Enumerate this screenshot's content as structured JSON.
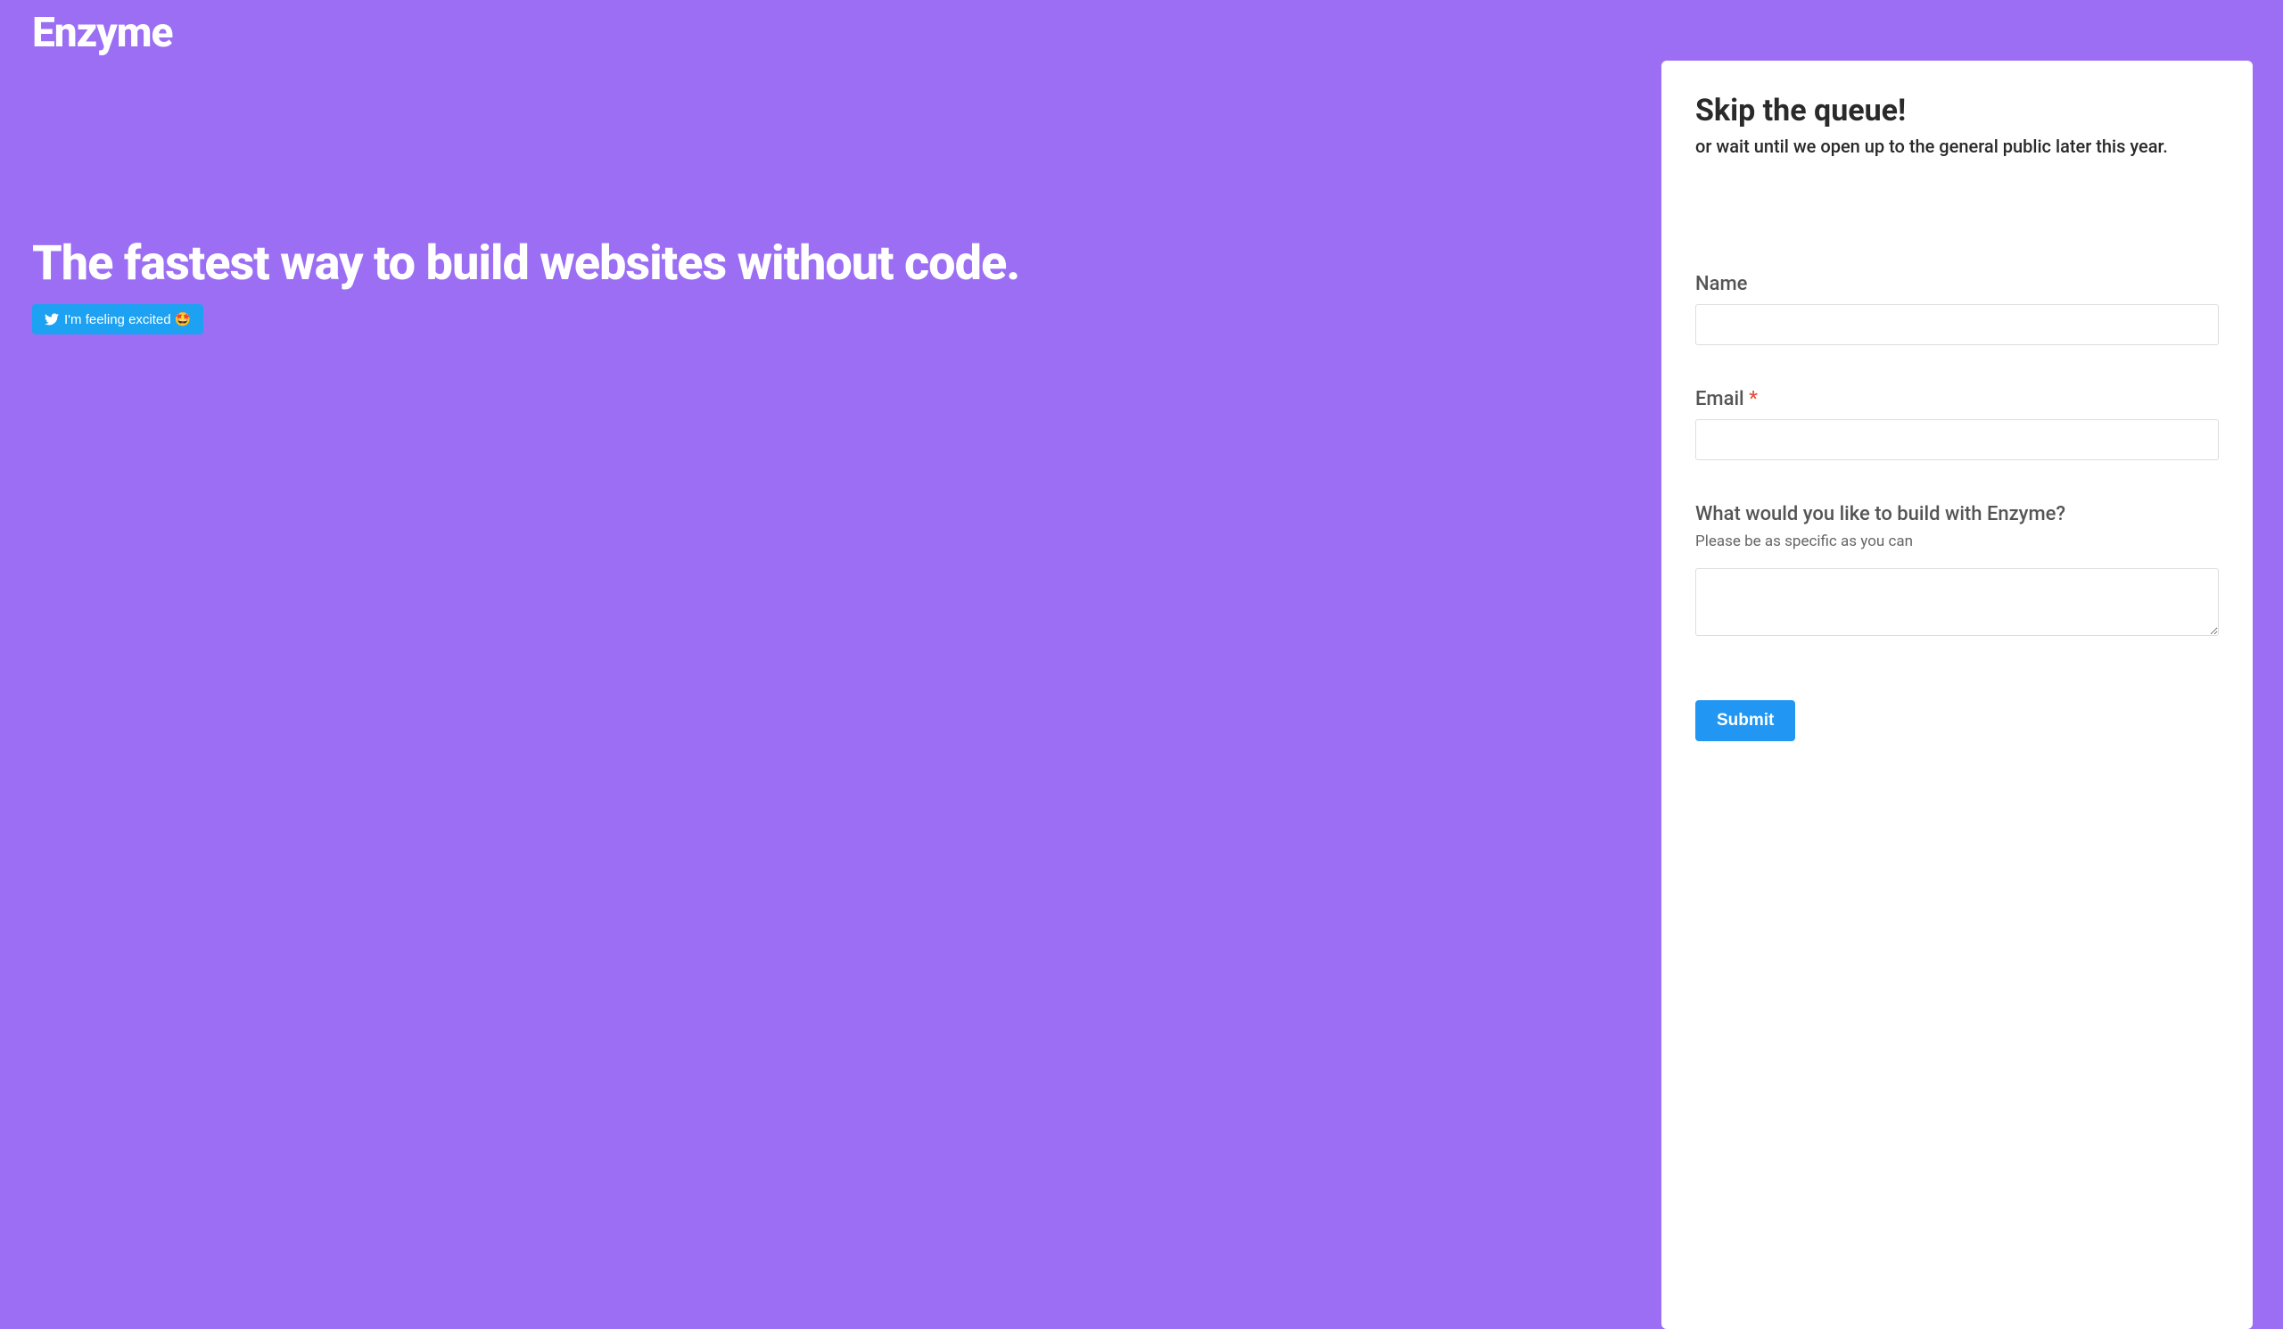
{
  "brand": {
    "name": "Enzyme"
  },
  "hero": {
    "title": "The fastest way to build websites without code.",
    "tweet_button_label": "I'm feeling excited 🤩"
  },
  "form": {
    "title": "Skip the queue!",
    "subtitle": "or wait until we open up to the general public later this year.",
    "fields": {
      "name": {
        "label": "Name",
        "value": ""
      },
      "email": {
        "label": "Email",
        "required_marker": "*",
        "value": ""
      },
      "build": {
        "label": "What would you like to build with Enzyme?",
        "hint": "Please be as specific as you can",
        "value": ""
      }
    },
    "submit_label": "Submit"
  }
}
